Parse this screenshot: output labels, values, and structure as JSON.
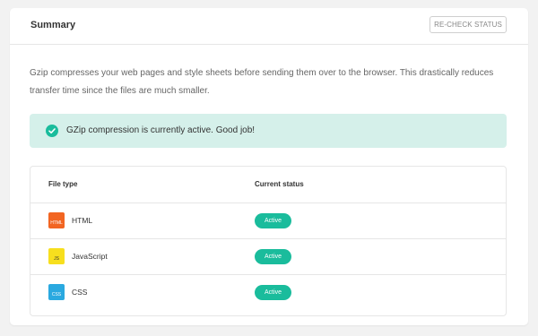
{
  "header": {
    "title": "Summary",
    "recheck_label": "RE-CHECK STATUS"
  },
  "intro_text": "Gzip compresses your web pages and style sheets before sending them over to the browser. This drastically reduces transfer time since the files are much smaller.",
  "notice": {
    "icon": "check-circle-icon",
    "text": "GZip compression is currently active. Good job!",
    "background": "#d5f0ea",
    "accent": "#1abc9c"
  },
  "table": {
    "columns": [
      "File type",
      "Current status"
    ],
    "rows": [
      {
        "icon_text": "HTML",
        "icon_color": "#f26522",
        "icon_text_color": "#ffffff",
        "name": "HTML",
        "status": "Active"
      },
      {
        "icon_text": "JS",
        "icon_color": "#f7df1e",
        "icon_text_color": "#333333",
        "name": "JavaScript",
        "status": "Active"
      },
      {
        "icon_text": "CSS",
        "icon_color": "#2aa9e0",
        "icon_text_color": "#ffffff",
        "name": "CSS",
        "status": "Active"
      }
    ]
  },
  "colors": {
    "status_active": "#1abc9c"
  }
}
